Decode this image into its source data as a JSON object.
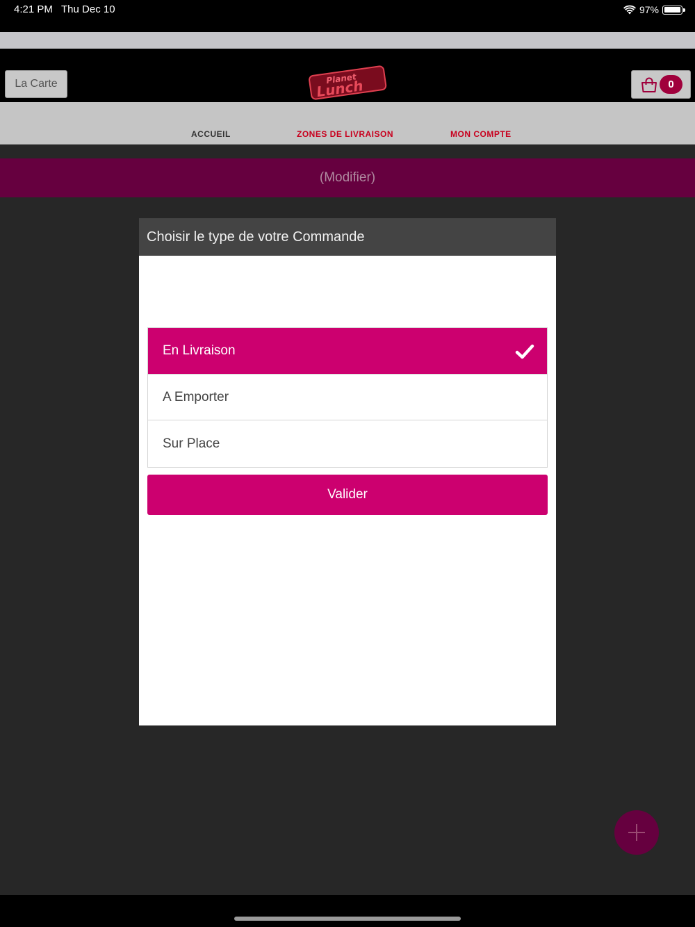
{
  "status_bar": {
    "time": "4:21 PM",
    "date": "Thu Dec 10",
    "battery": "97%",
    "battery_level": 0.97
  },
  "header": {
    "menu_button_label": "La Carte",
    "logo_text": "Planet Lunch",
    "cart_count": "0"
  },
  "nav": {
    "items": [
      {
        "label": "ACCUEIL"
      },
      {
        "label": "ZONES DE LIVRAISON"
      },
      {
        "label": "MON COMPTE"
      }
    ]
  },
  "banner": {
    "modify_label": "(Modifier)"
  },
  "modal": {
    "title": "Choisir le type de votre Commande",
    "options": [
      {
        "label": "En Livraison",
        "selected": true
      },
      {
        "label": "A Emporter",
        "selected": false
      },
      {
        "label": "Sur Place",
        "selected": false
      }
    ],
    "validate_label": "Valider"
  },
  "colors": {
    "accent": "#cc006f",
    "accent_dark": "#66003f",
    "nav_active": "#c8001e"
  },
  "icons": {
    "wifi": "wifi-icon",
    "battery": "battery-icon",
    "cart": "shopping-bag-icon",
    "check": "check-icon",
    "add": "plus-icon"
  }
}
